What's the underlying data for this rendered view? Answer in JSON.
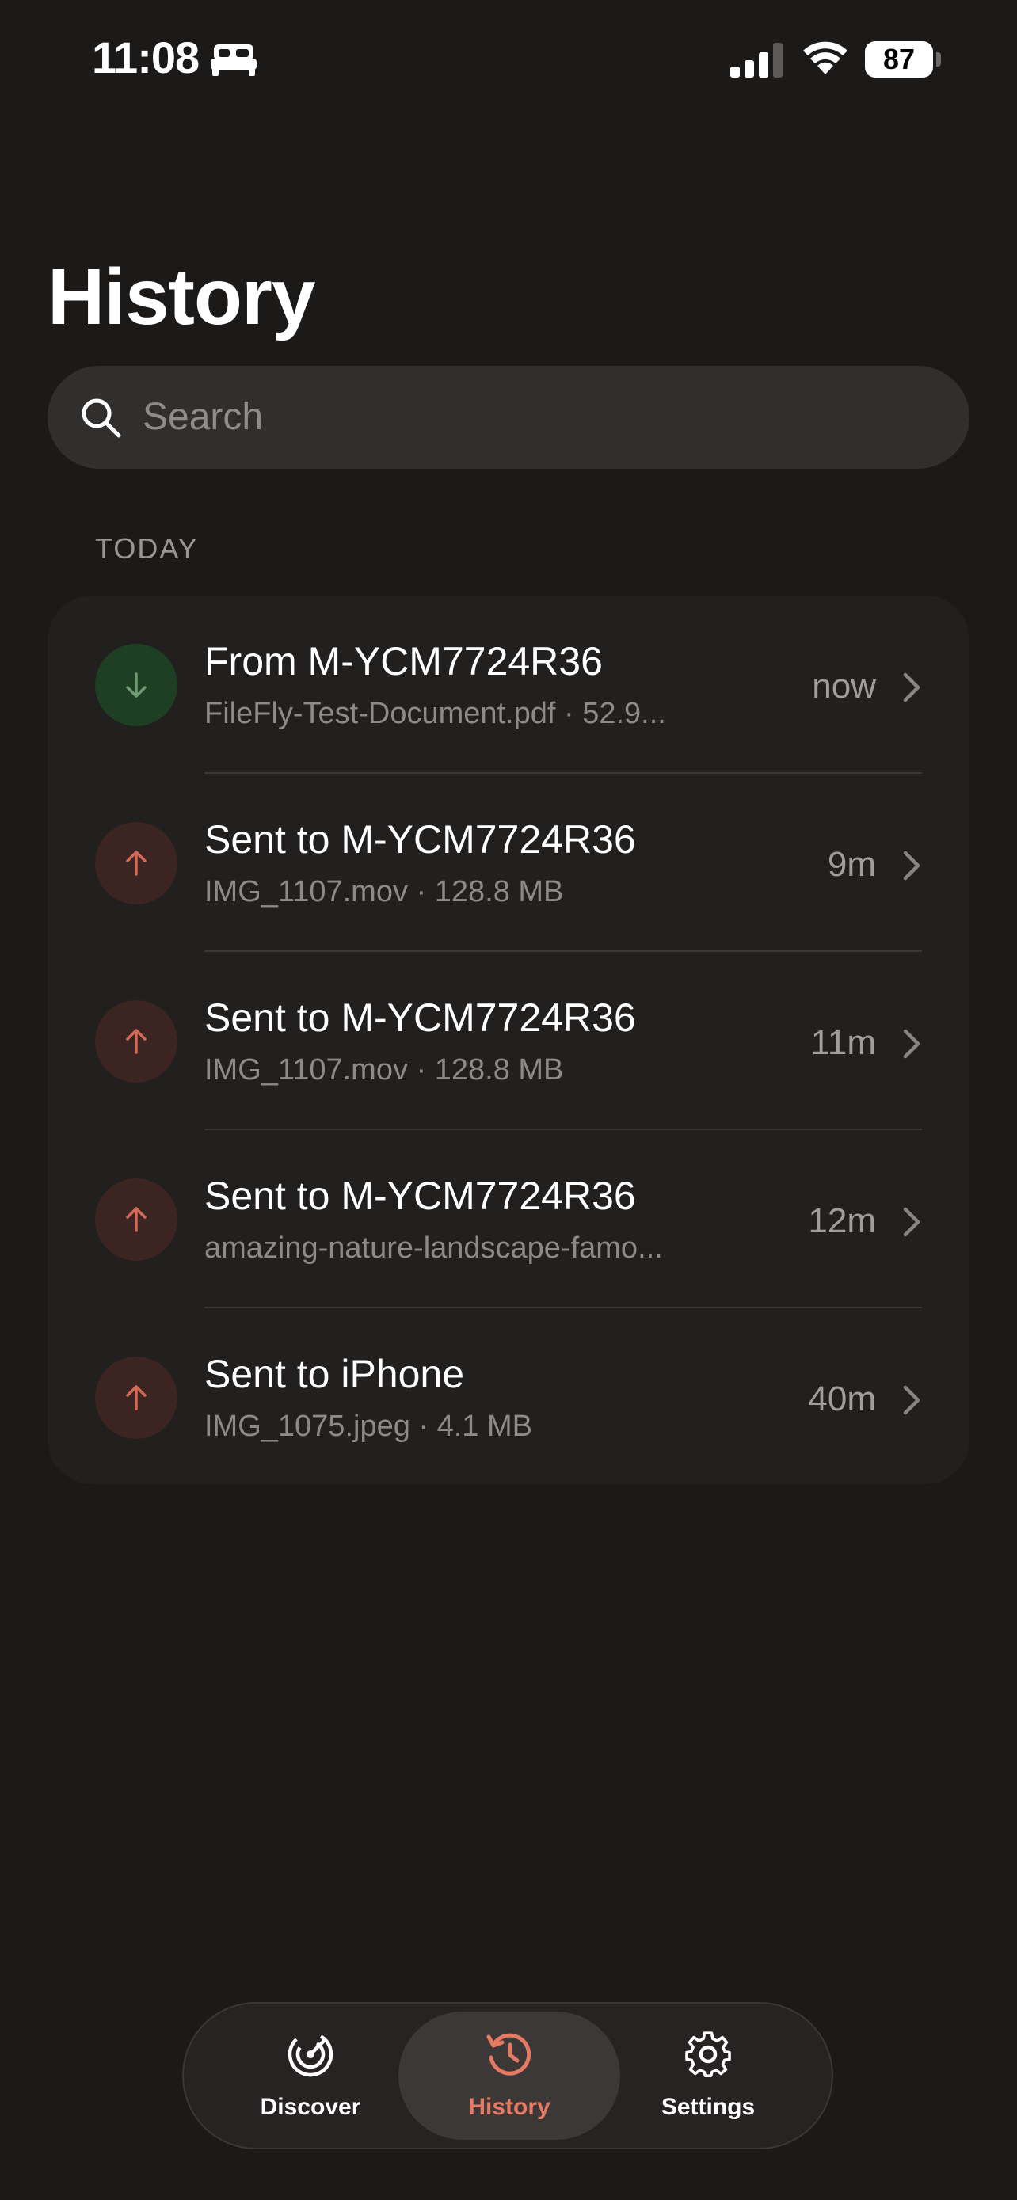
{
  "status_bar": {
    "time": "11:08",
    "battery": "87",
    "icons": [
      "bed-icon",
      "cellular-signal-icon",
      "wifi-icon",
      "battery-icon"
    ]
  },
  "header": {
    "title": "History"
  },
  "search": {
    "placeholder": "Search"
  },
  "sections": [
    {
      "label": "TODAY",
      "items": [
        {
          "direction": "received",
          "icon": "arrow-down-icon",
          "title": "From M-YCM7724R36",
          "subtitle": "FileFly-Test-Document.pdf · 52.9...",
          "time": "now"
        },
        {
          "direction": "sent",
          "icon": "arrow-up-icon",
          "title": "Sent to M-YCM7724R36",
          "subtitle": "IMG_1107.mov · 128.8 MB",
          "time": "9m"
        },
        {
          "direction": "sent",
          "icon": "arrow-up-icon",
          "title": "Sent to M-YCM7724R36",
          "subtitle": "IMG_1107.mov · 128.8 MB",
          "time": "11m"
        },
        {
          "direction": "sent",
          "icon": "arrow-up-icon",
          "title": "Sent to M-YCM7724R36",
          "subtitle": "amazing-nature-landscape-famo...",
          "time": "12m"
        },
        {
          "direction": "sent",
          "icon": "arrow-up-icon",
          "title": "Sent to iPhone",
          "subtitle": "IMG_1075.jpeg · 4.1 MB",
          "time": "40m"
        }
      ]
    }
  ],
  "tab_bar": {
    "tabs": [
      {
        "label": "Discover",
        "icon": "radar-icon",
        "active": false
      },
      {
        "label": "History",
        "icon": "history-icon",
        "active": true
      },
      {
        "label": "Settings",
        "icon": "gear-icon",
        "active": false
      }
    ]
  },
  "colors": {
    "background": "#1c1919",
    "card": "#221f1f",
    "received_icon_bg": "#1f3f24",
    "received_arrow": "#6f9a72",
    "sent_icon_bg": "#3c2422",
    "sent_arrow": "#d36a57",
    "accent": "#e67a62"
  }
}
